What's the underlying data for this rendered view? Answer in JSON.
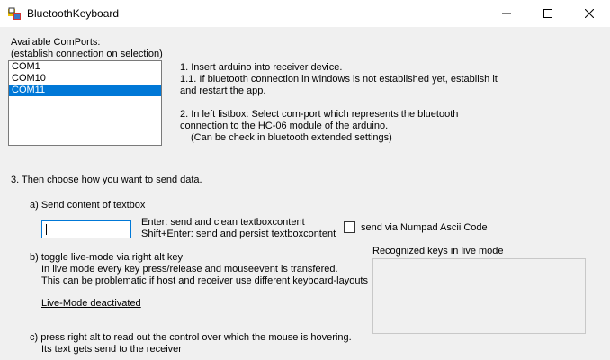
{
  "window": {
    "title": "BluetoothKeyboard",
    "icon": "app-icon",
    "controls": [
      "minimize-icon",
      "maximize-icon",
      "close-icon"
    ]
  },
  "comports": {
    "label_line1": "Available ComPorts:",
    "label_line2": "(establish connection on selection)",
    "items": [
      "COM1",
      "COM10",
      "COM11"
    ],
    "selected": "COM11"
  },
  "instructions": {
    "line1": "1. Insert arduino into receiver device.",
    "line2": "1.1. If bluetooth connection in windows is not established yet, establish it",
    "line3": "and restart the app.",
    "line4": "2. In left listbox: Select com-port which represents the bluetooth",
    "line5": "connection to the HC-06 module of the arduino.",
    "line6": "(Can be check in bluetooth extended settings)"
  },
  "section3": {
    "heading": "3. Then choose how you want to send data.",
    "a_label": "a) Send content of textbox",
    "textbox_value": "",
    "enter_hint": "Enter: send and clean textboxcontent",
    "shift_enter_hint": "Shift+Enter: send and persist textboxcontent",
    "numpad_checkbox_label": "send via Numpad Ascii Code",
    "numpad_checked": false,
    "b_label": "b) toggle live-mode via right alt key",
    "b_line1": "In live mode every key press/release and mouseevent is transfered.",
    "b_line2": "This can be problematic if host and receiver use different keyboard-layouts",
    "live_mode_status": "Live-Mode deactivated",
    "recognized_keys_label": "Recognized keys in live mode",
    "c_label": "c) press right alt to read out the control over which the mouse is hovering.",
    "c_line1": "Its text gets send to the receiver"
  }
}
